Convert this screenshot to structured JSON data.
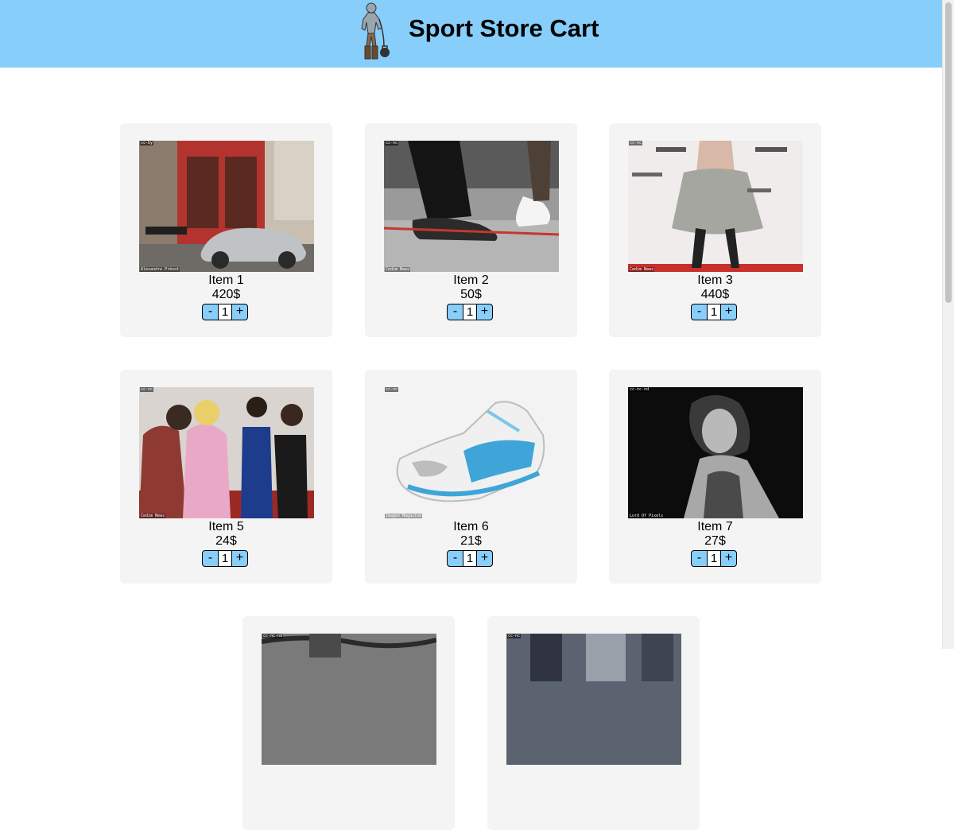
{
  "header": {
    "title": "Sport Store Cart",
    "background": "#87cefa"
  },
  "controls": {
    "minus": "-",
    "plus": "+"
  },
  "items": [
    {
      "name": "Item 1",
      "price": "420$",
      "qty": "1",
      "license": "cc-by",
      "credit": "Alexandre Prévot"
    },
    {
      "name": "Item 2",
      "price": "50$",
      "qty": "1",
      "license": "cc-nc",
      "credit": "Cedim News"
    },
    {
      "name": "Item 3",
      "price": "440$",
      "qty": "1",
      "license": "cc-nc",
      "credit": "Cedim News"
    },
    {
      "name": "Item 5",
      "price": "24$",
      "qty": "1",
      "license": "cc-nc",
      "credit": "Cedim News"
    },
    {
      "name": "Item 6",
      "price": "21$",
      "qty": "1",
      "license": "cc-nc",
      "credit": "Imagen Magazine"
    },
    {
      "name": "Item 7",
      "price": "27$",
      "qty": "1",
      "license": "cc-nc-nd",
      "credit": "Lord Of Pixels"
    },
    {
      "license": "cc-nc-nd"
    },
    {
      "license": "cc-nc"
    }
  ]
}
